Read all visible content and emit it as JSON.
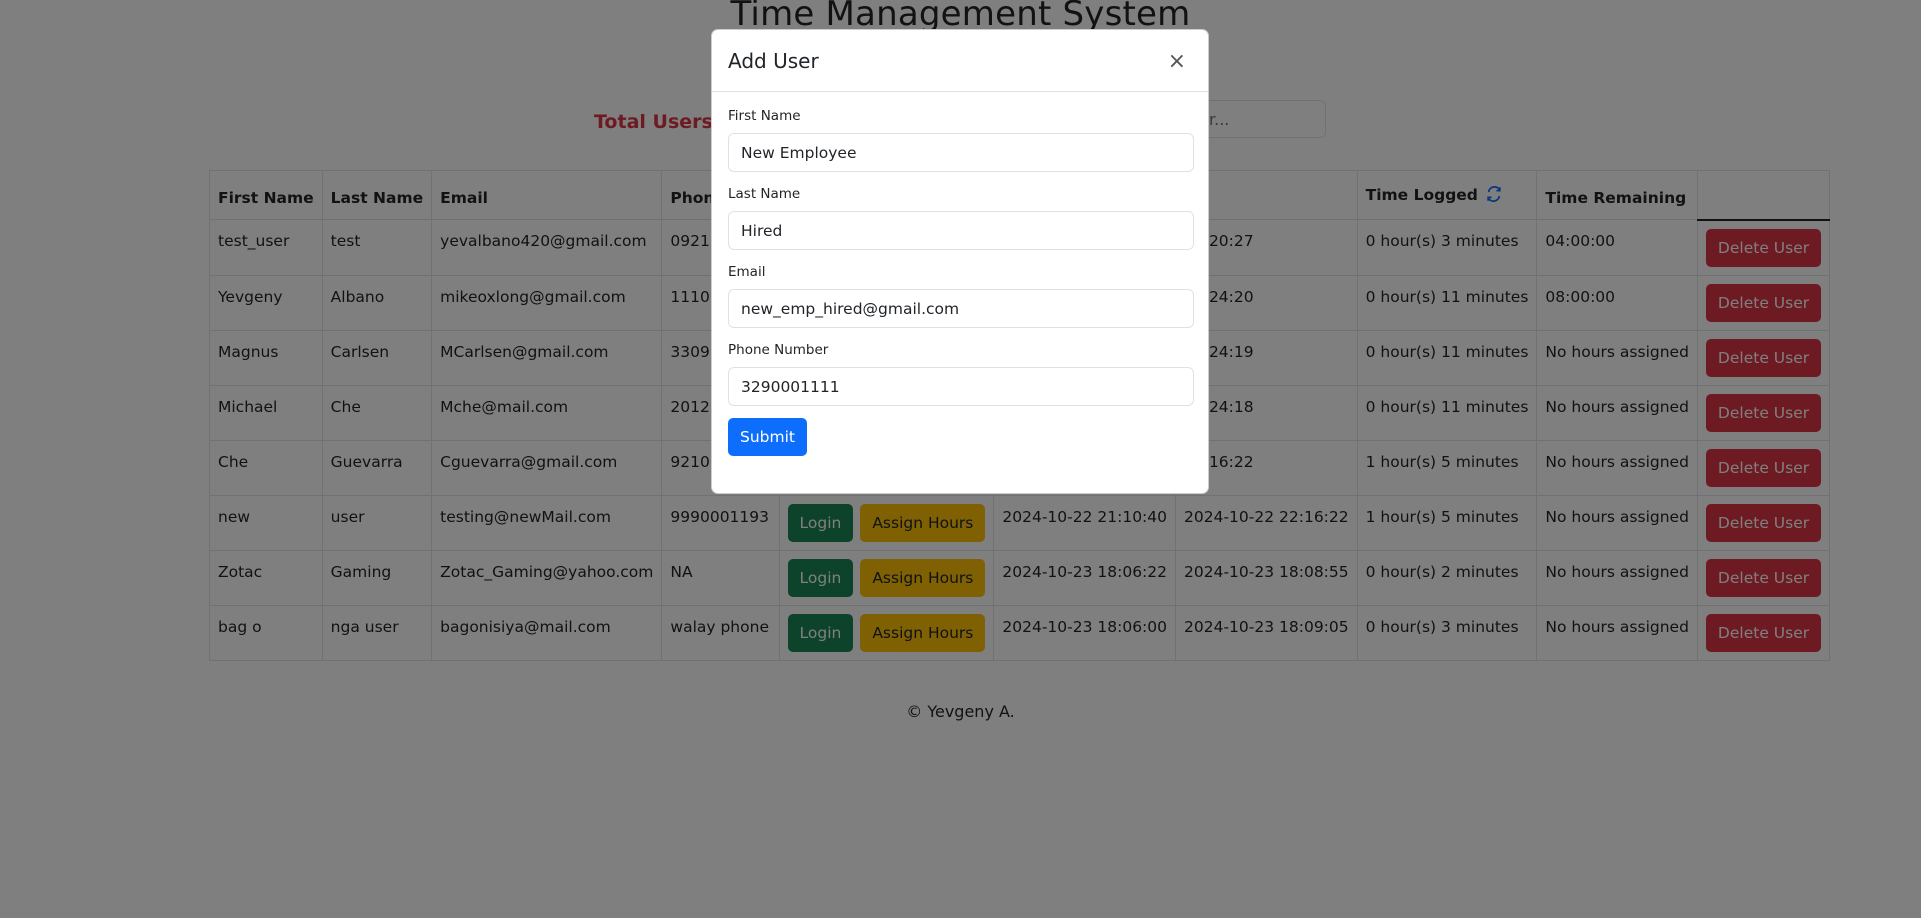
{
  "page": {
    "title": "Time Management System",
    "total_users_label": "Total Users Lo",
    "search_placeholder": "r...",
    "footer": "© Yevgeny A."
  },
  "table": {
    "headers": {
      "first_name": "First Name",
      "last_name": "Last Name",
      "email": "Email",
      "phone": "Phone Num",
      "actions": "",
      "login_time": "",
      "logout_time": "",
      "time_logged": "Time Logged",
      "time_remaining": "Time Remaining",
      "delete": ""
    },
    "buttons": {
      "login": "Login",
      "assign": "Assign Hours",
      "delete": "Delete User"
    },
    "rows": [
      {
        "first": "test_user",
        "last": "test",
        "email": "yevalbano420@gmail.com",
        "phone": "0921270794",
        "login_time": "",
        "logout_time": "11:20:27",
        "logged": "0 hour(s) 3 minutes",
        "remaining": "04:00:00"
      },
      {
        "first": "Yevgeny",
        "last": "Albano",
        "email": "mikeoxlong@gmail.com",
        "phone": "1110002929",
        "login_time": "",
        "logout_time": "10:24:20",
        "logged": "0 hour(s) 11 minutes",
        "remaining": "08:00:00"
      },
      {
        "first": "Magnus",
        "last": "Carlsen",
        "email": "MCarlsen@gmail.com",
        "phone": "3309108739",
        "login_time": "",
        "logout_time": "10:24:19",
        "logged": "0 hour(s) 11 minutes",
        "remaining": "No hours assigned"
      },
      {
        "first": "Michael",
        "last": "Che",
        "email": "Mche@mail.com",
        "phone": "2012001998",
        "login_time": "",
        "logout_time": "10:24:18",
        "logged": "0 hour(s) 11 minutes",
        "remaining": "No hours assigned"
      },
      {
        "first": "Che",
        "last": "Guevarra",
        "email": "Cguevarra@gmail.com",
        "phone": "9210009918",
        "login_time": "",
        "logout_time": "22:16:22",
        "logged": "1 hour(s) 5 minutes",
        "remaining": "No hours assigned"
      },
      {
        "first": "new",
        "last": "user",
        "email": "testing@newMail.com",
        "phone": "9990001193",
        "login_time": "2024-10-22 21:10:40",
        "logout_time": "2024-10-22 22:16:22",
        "logged": "1 hour(s) 5 minutes",
        "remaining": "No hours assigned"
      },
      {
        "first": "Zotac",
        "last": "Gaming",
        "email": "Zotac_Gaming@yahoo.com",
        "phone": "NA",
        "login_time": "2024-10-23 18:06:22",
        "logout_time": "2024-10-23 18:08:55",
        "logged": "0 hour(s) 2 minutes",
        "remaining": "No hours assigned"
      },
      {
        "first": "bag o",
        "last": "nga user",
        "email": "bagonisiya@mail.com",
        "phone": "walay phone",
        "login_time": "2024-10-23 18:06:00",
        "logout_time": "2024-10-23 18:09:05",
        "logged": "0 hour(s) 3 minutes",
        "remaining": "No hours assigned"
      }
    ]
  },
  "modal": {
    "title": "Add User",
    "close_glyph": "×",
    "fields": {
      "first_name": {
        "label": "First Name",
        "value": "New Employee"
      },
      "last_name": {
        "label": "Last Name",
        "value": "Hired"
      },
      "email": {
        "label": "Email",
        "value": "new_emp_hired@gmail.com"
      },
      "phone": {
        "label": "Phone Number",
        "value": "3290001111"
      }
    },
    "submit_label": "Submit"
  },
  "colors": {
    "primary": "#0d6efd",
    "success": "#198754",
    "warning": "#ffc107",
    "danger": "#dc3545",
    "backdrop": "rgba(0,0,0,0.5)"
  },
  "icons": {
    "refresh": "refresh-icon",
    "close": "close-icon"
  }
}
